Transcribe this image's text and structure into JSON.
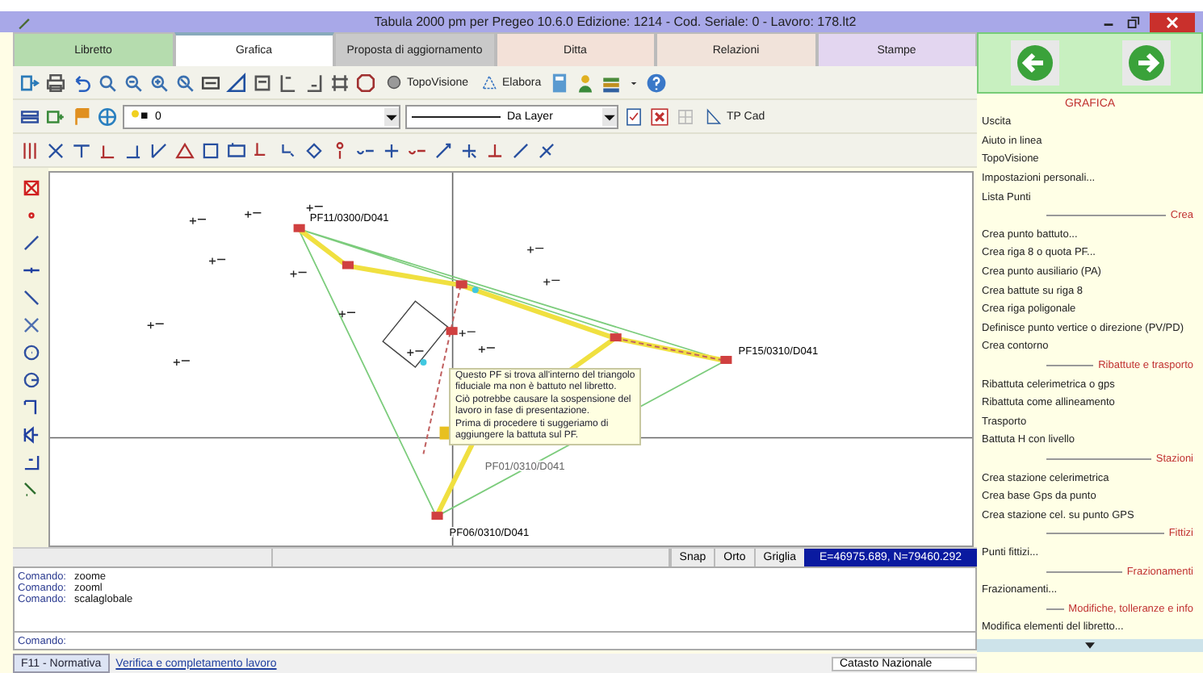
{
  "window": {
    "title": "Tabula 2000 pm per Pregeo 10.6.0 Edizione: 1214 - Cod. Seriale: 0 - Lavoro: 178.lt2"
  },
  "tabs": [
    {
      "label": "Libretto",
      "selected": false,
      "color": "#b5dcae"
    },
    {
      "label": "Grafica",
      "selected": true,
      "color": "#ffffff"
    },
    {
      "label": "Proposta di aggiornamento",
      "selected": false,
      "color": "#c9c9c9"
    },
    {
      "label": "Ditta",
      "selected": false,
      "color": "#f3e1d8"
    },
    {
      "label": "Relazioni",
      "selected": false,
      "color": "#f1e3da"
    },
    {
      "label": "Stampe",
      "selected": false,
      "color": "#e3d6f0"
    }
  ],
  "toolbar": {
    "topovisione": "TopoVisione",
    "elabora": "Elabora",
    "layer": "0",
    "linetype": "Da Layer",
    "tpcad": "TP Cad"
  },
  "drawing": {
    "point_labels": [
      "PF11/0300/D041",
      "PF15/0310/D041",
      "PF01/0310/D041",
      "PF06/0310/D041"
    ],
    "tooltip": [
      "Questo PF si trova all'interno del triangolo",
      "fiduciale ma non è battuto nel libretto.",
      "Ciò potrebbe causare la sospensione del",
      "lavoro in fase di presentazione.",
      "Prima di procedere ti suggeriamo di",
      "aggiungere la battuta sul PF."
    ]
  },
  "status": {
    "snap": "Snap",
    "orto": "Orto",
    "griglia": "Griglia",
    "coordinates": "E=46975.689, N=79460.292"
  },
  "command_log": [
    {
      "prompt": "Comando:",
      "command": "zoome"
    },
    {
      "prompt": "Comando:",
      "command": "zooml"
    },
    {
      "prompt": "Comando:",
      "command": "scalaglobale"
    }
  ],
  "command_line": {
    "prompt": "Comando:"
  },
  "bottom_bar": {
    "tab": "F11 - Normativa",
    "link": "Verifica e completamento lavoro",
    "region": "Catasto Nazionale"
  },
  "panel": {
    "title": "GRAFICA",
    "menu": [
      {
        "kind": "item",
        "label": "Uscita"
      },
      {
        "kind": "item",
        "label": "Aiuto in linea"
      },
      {
        "kind": "item",
        "label": "TopoVisione"
      },
      {
        "kind": "item",
        "label": "Impostazioni personali..."
      },
      {
        "kind": "item",
        "label": "Lista Punti"
      },
      {
        "kind": "section",
        "label": "Crea"
      },
      {
        "kind": "item",
        "label": "Crea punto battuto..."
      },
      {
        "kind": "item",
        "label": "Crea riga 8 o quota PF..."
      },
      {
        "kind": "item",
        "label": "Crea punto ausiliario (PA)"
      },
      {
        "kind": "item",
        "label": "Crea battute su riga 8"
      },
      {
        "kind": "item",
        "label": "Crea riga poligonale"
      },
      {
        "kind": "item",
        "label": "Definisce punto vertice o direzione (PV/PD)"
      },
      {
        "kind": "item",
        "label": "Crea contorno"
      },
      {
        "kind": "section",
        "label": "Ribattute e trasporto"
      },
      {
        "kind": "item",
        "label": "Ribattuta celerimetrica o gps"
      },
      {
        "kind": "item",
        "label": "Ribattuta come allineamento"
      },
      {
        "kind": "item",
        "label": "Trasporto"
      },
      {
        "kind": "item",
        "label": "Battuta H con livello"
      },
      {
        "kind": "section",
        "label": "Stazioni"
      },
      {
        "kind": "item",
        "label": "Crea stazione celerimetrica"
      },
      {
        "kind": "item",
        "label": "Crea base Gps da punto"
      },
      {
        "kind": "item",
        "label": "Crea stazione cel. su punto GPS"
      },
      {
        "kind": "section",
        "label": "Fittizi"
      },
      {
        "kind": "item",
        "label": "Punti fittizi..."
      },
      {
        "kind": "section",
        "label": "Frazionamenti"
      },
      {
        "kind": "item",
        "label": "Frazionamenti..."
      },
      {
        "kind": "section",
        "label": "Modifiche, tolleranze e info"
      },
      {
        "kind": "item",
        "label": "Modifica elementi del libretto..."
      }
    ]
  }
}
